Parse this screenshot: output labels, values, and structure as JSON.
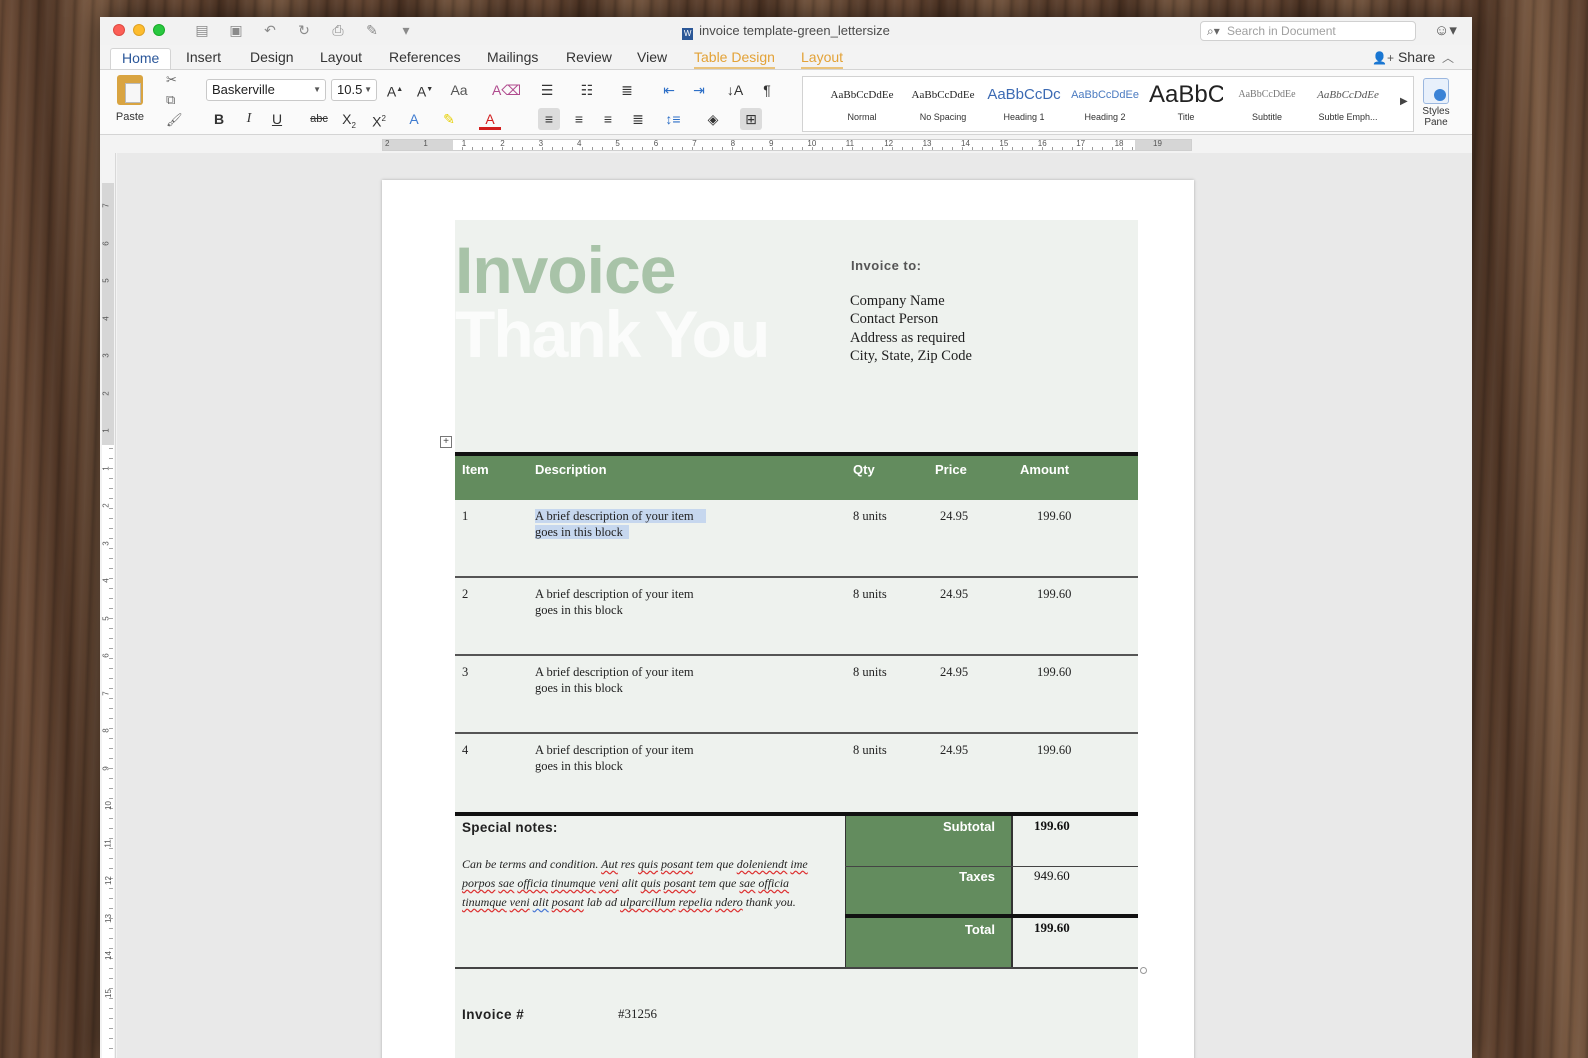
{
  "window": {
    "title": "invoice template-green_lettersize",
    "search_placeholder": "Search in Document",
    "share_label": "Share"
  },
  "tabs": [
    {
      "label": "Home",
      "active": true
    },
    {
      "label": "Insert"
    },
    {
      "label": "Design"
    },
    {
      "label": "Layout"
    },
    {
      "label": "References"
    },
    {
      "label": "Mailings"
    },
    {
      "label": "Review"
    },
    {
      "label": "View"
    },
    {
      "label": "Table Design",
      "contextual": true
    },
    {
      "label": "Layout",
      "contextual": true
    }
  ],
  "ribbon": {
    "paste_label": "Paste",
    "font_name": "Baskerville",
    "font_size": "10.5",
    "styles": [
      {
        "sample": "AaBbCcDdEe",
        "name": "Normal"
      },
      {
        "sample": "AaBbCcDdEe",
        "name": "No Spacing"
      },
      {
        "sample": "AaBbCcDc",
        "name": "Heading 1"
      },
      {
        "sample": "AaBbCcDdEe",
        "name": "Heading 2"
      },
      {
        "sample": "AaBbC",
        "name": "Title"
      },
      {
        "sample": "AaBbCcDdEe",
        "name": "Subtitle"
      },
      {
        "sample": "AaBbCcDdEe",
        "name": "Subtle Emph..."
      }
    ],
    "styles_pane_label": "Styles Pane",
    "accent_color": "#2b579a",
    "contextual_color": "#e3a237"
  },
  "ruler": {
    "h_numbers": [
      "2",
      "1",
      "1",
      "2",
      "3",
      "4",
      "5",
      "6",
      "7",
      "8",
      "9",
      "10",
      "11",
      "12",
      "13",
      "14",
      "15",
      "16",
      "17",
      "18",
      "19"
    ],
    "v_numbers": [
      "7",
      "6",
      "5",
      "4",
      "3",
      "2",
      "1",
      "1",
      "2",
      "3",
      "4",
      "5",
      "6",
      "7",
      "8",
      "9",
      "10",
      "11",
      "12",
      "13",
      "14",
      "15"
    ]
  },
  "document": {
    "heading_invoice": "Invoice",
    "heading_thanks": "Thank You",
    "invoice_to_label": "Invoice to:",
    "invoice_to_lines": [
      "Company Name",
      "Contact Person",
      "Address as required",
      "City, State, Zip Code"
    ],
    "table_headers": [
      "Item",
      "Description",
      "Qty",
      "Price",
      "Amount"
    ],
    "rows": [
      {
        "item": "1",
        "desc1": "A brief description of your item",
        "desc2": "goes in this block",
        "qty": "8 units",
        "price": "24.95",
        "amount": "199.60"
      },
      {
        "item": "2",
        "desc1": "A brief description of your item",
        "desc2": "goes in this block",
        "qty": "8 units",
        "price": "24.95",
        "amount": "199.60"
      },
      {
        "item": "3",
        "desc1": "A brief description of your item",
        "desc2": "goes in this block",
        "qty": "8 units",
        "price": "24.95",
        "amount": "199.60"
      },
      {
        "item": "4",
        "desc1": "A brief description of your item",
        "desc2": "goes in this block",
        "qty": "8 units",
        "price": "24.95",
        "amount": "199.60"
      }
    ],
    "special_notes_label": "Special notes:",
    "special_notes_lines": [
      [
        "Can be terms and condition. ",
        "Aut",
        " res ",
        "quis",
        " ",
        "posant",
        " tem que ",
        "doleniendt",
        " ",
        "ime"
      ],
      [
        "porpos",
        " ",
        "sae",
        " ",
        "officia",
        " ",
        "tinumque",
        " ",
        "veni",
        " alit ",
        "quis",
        " ",
        "posant",
        " tem que ",
        "sae",
        " ",
        "officia"
      ],
      [
        "tinumque",
        " ",
        "veni",
        " ",
        "alit",
        " ",
        "posant",
        " lab ad ",
        "ulparcillum",
        " ",
        "repelia",
        " ",
        "ndero",
        " thank you."
      ]
    ],
    "subtotal_label": "Subtotal",
    "subtotal_value": "199.60",
    "taxes_label": "Taxes",
    "taxes_value": "949.60",
    "total_label": "Total",
    "total_value": "199.60",
    "invoice_number_label": "Invoice #",
    "invoice_number_value": "#31256",
    "table_header_color": "#638c5e"
  }
}
